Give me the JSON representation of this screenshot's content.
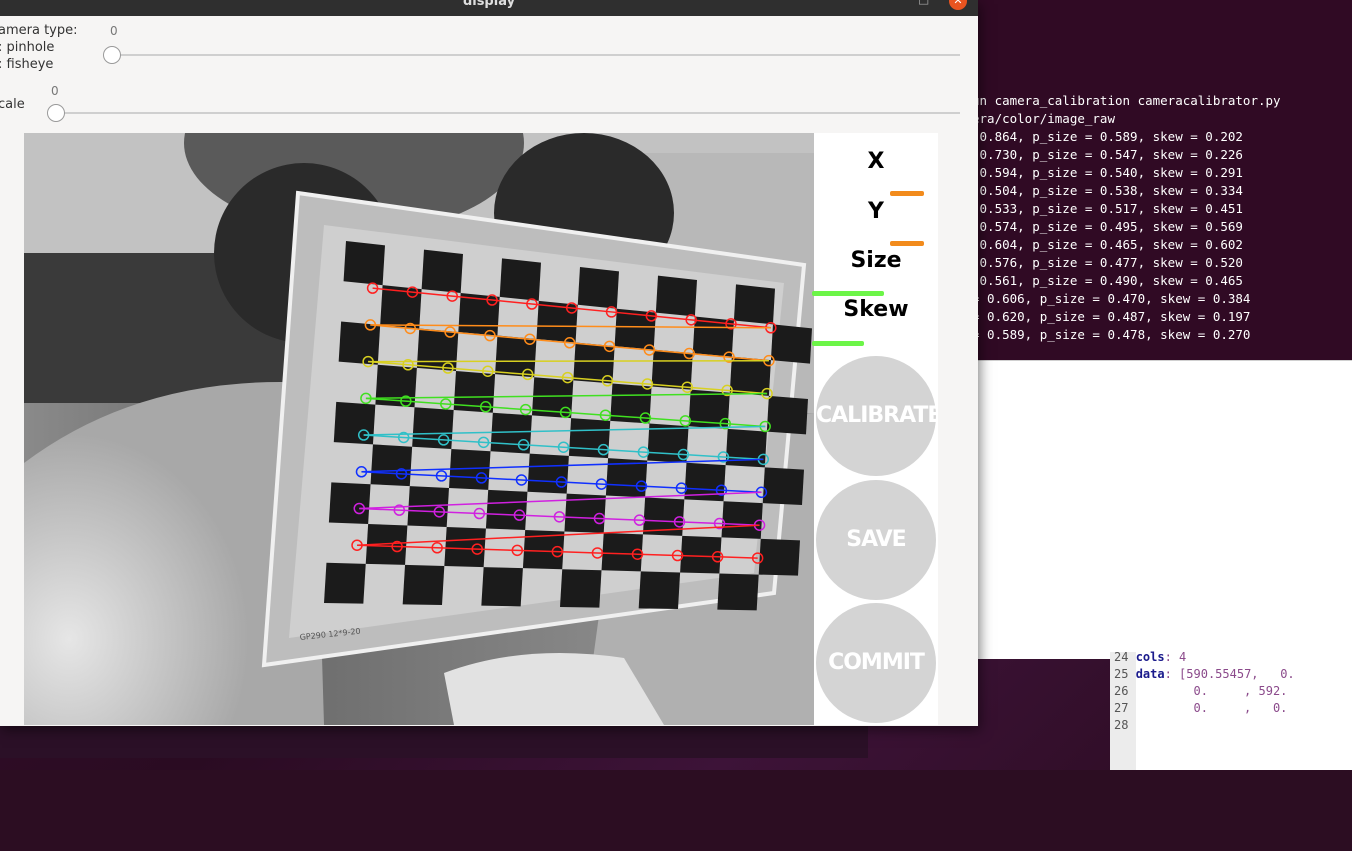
{
  "window": {
    "title": "display"
  },
  "controls": {
    "camera_type": {
      "label_lines": [
        "amera type:",
        ": pinhole",
        ": fisheye"
      ],
      "value": "0",
      "level": 0
    },
    "scale": {
      "label": "cale",
      "value": "0",
      "level": 0
    }
  },
  "sidebar": {
    "metrics": [
      {
        "label": "X",
        "bar_color": "#f28b1c",
        "level": 0.42
      },
      {
        "label": "Y",
        "bar_color": "#f28b1c",
        "level": 0.42
      },
      {
        "label": "Size",
        "bar_color": "#6cf548",
        "level": 0.9
      },
      {
        "label": "Skew",
        "bar_color": "#6cf548",
        "level": 0.65
      }
    ],
    "buttons": [
      "CALIBRATE",
      "SAVE",
      "COMMIT"
    ]
  },
  "checkerboard": {
    "label": "GP290  12*9-20",
    "row_colors": [
      "#ff2020",
      "#ff8c1a",
      "#d8d020",
      "#40e020",
      "#30c0c8",
      "#1030ff",
      "#d020e0",
      "#ff2020"
    ]
  },
  "terminal": {
    "lines": [
      "un camera_calibration cameracalibrator.py",
      "era/color/image_raw",
      " 0.864, p_size = 0.589, skew = 0.202",
      " 0.730, p_size = 0.547, skew = 0.226",
      " 0.594, p_size = 0.540, skew = 0.291",
      " 0.504, p_size = 0.538, skew = 0.334",
      " 0.533, p_size = 0.517, skew = 0.451",
      " 0.574, p_size = 0.495, skew = 0.569",
      " 0.604, p_size = 0.465, skew = 0.602",
      " 0.576, p_size = 0.477, skew = 0.520",
      " 0.561, p_size = 0.490, skew = 0.465",
      "= 0.606, p_size = 0.470, skew = 0.384",
      "= 0.620, p_size = 0.487, skew = 0.197",
      "= 0.589, p_size = 0.478, skew = 0.270"
    ]
  },
  "editor": {
    "lines": [
      {
        "num": "24",
        "key": "cols",
        "rest": ": 4"
      },
      {
        "num": "25",
        "key": "data",
        "rest": ": [590.55457,   0."
      },
      {
        "num": "26",
        "key": "",
        "rest": "        0.     , 592."
      },
      {
        "num": "27",
        "key": "",
        "rest": "        0.     ,   0."
      },
      {
        "num": "28",
        "key": "",
        "rest": ""
      }
    ]
  }
}
